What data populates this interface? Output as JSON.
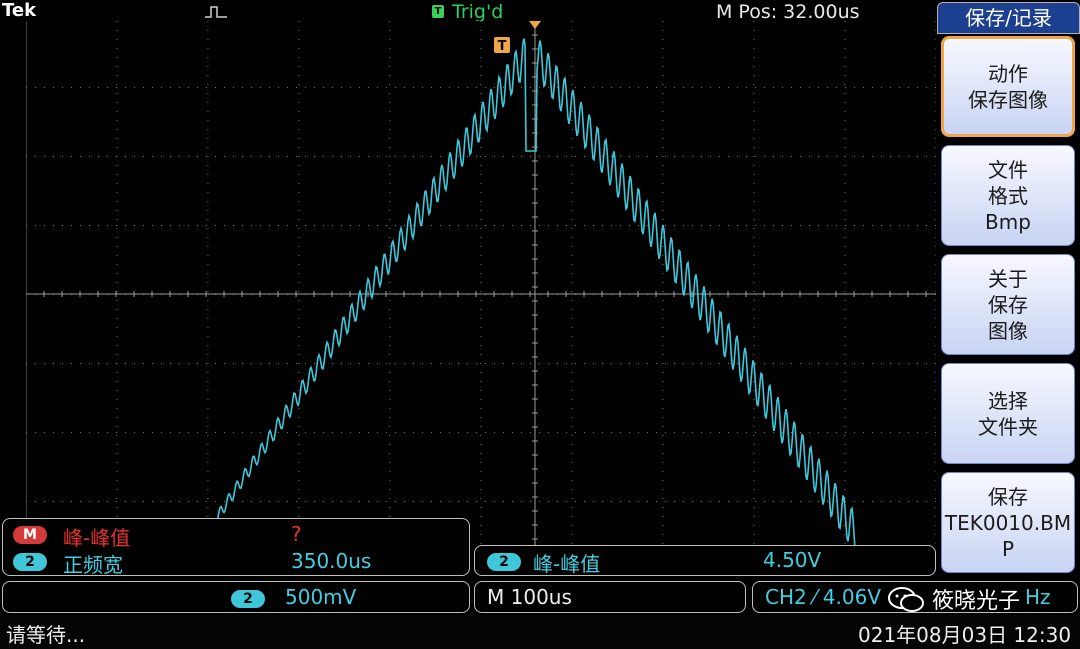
{
  "header": {
    "brand": "Tek",
    "trigger_status": "Trig'd",
    "trigger_icon": "T",
    "mpos": "M Pos: 32.00us",
    "trigger_marker": "T"
  },
  "menu": {
    "title": "保存/记录",
    "items": [
      {
        "lines": [
          "动作",
          "保存图像"
        ],
        "active": true
      },
      {
        "lines": [
          "文件",
          "格式",
          "Bmp"
        ]
      },
      {
        "lines": [
          "关于",
          "保存",
          "图像"
        ]
      },
      {
        "lines": [
          "选择",
          "文件夹"
        ]
      },
      {
        "lines": [
          "保存",
          "TEK0010.BM",
          "P"
        ]
      }
    ]
  },
  "measurements": {
    "m_badge": "M",
    "m_label": "峰-峰值",
    "m_value": "?",
    "ch2_badge": "2",
    "ch2_label": "正频宽",
    "ch2_value": "350.0us",
    "right_badge": "2",
    "right_label": "峰-峰值",
    "right_value": "4.50V"
  },
  "scale_bar": {
    "ch_badge": "2",
    "volts": "500mV",
    "timebase": "M 100us",
    "trigger": "CH2 ⁄ 4.06V",
    "freq_fragment": "Hz"
  },
  "watermark": "筱晓光子",
  "status_bar": {
    "left": "请等待...",
    "right": "021年08月03日 12:30"
  },
  "colors": {
    "trace": "#3fc6d8",
    "grid": "#8a8a8a",
    "trigger_green": "#28d160",
    "accent_orange": "#f0a54a"
  },
  "chart_data": {
    "type": "line",
    "description_series": "CH2",
    "grid_divisions": {
      "x": 10,
      "y": 8
    }
  }
}
